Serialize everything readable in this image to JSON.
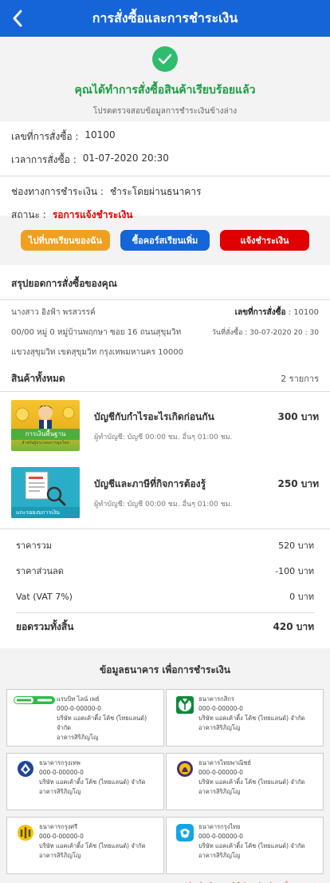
{
  "header": {
    "title": "การสั่งซื้อและการชำระเงิน"
  },
  "success": {
    "message": "คุณได้ทำการสั่งซื้อสินค้าเรียบร้อยแล้ว",
    "sub": "โปรดตรวจสอบข้อมูลการชำระเงินข้างล่าง"
  },
  "order": {
    "number_label": "เลขที่การสั่งซื้อ :",
    "number": "10100",
    "time_label": "เวลาการสั่งซื้อ :",
    "time": "01-07-2020 20:30",
    "payment_label": "ช่องทางการชำระเงิน :",
    "payment": "ชำระโดยผ่านธนาคาร",
    "status_label": "สถานะ :",
    "status": "รอการแจ้งชำระเงิน",
    "status_color": "#e00000"
  },
  "buttons": {
    "my_courses": "ไปที่บทเรียนของฉัน",
    "buy_more": "ซื้อคอร์สเรียนเพิ่ม",
    "notify_payment": "แจ้งชำระเงิน"
  },
  "summary": {
    "title": "สรุปยอดการสั่งซื้อของคุณ",
    "customer_name": "นางสาว อิงฟ้า พรสวรรค์",
    "order_no_label": "เลขที่การสั่งซื้อ",
    "order_no": ": 10100",
    "address1": "00/00 หมู่ 0 หมู่บ้านพฤกษา ซอย 16 ถนนสุขุมวิท",
    "order_date": "วันที่สั่งซื้อ : 30-07-2020 20 : 30",
    "address2": "แขวงสุขุมวิท เขตสุขุมวิท กรุงเทพมหานคร 10000",
    "items_title": "สินค้าทั้งหมด",
    "items_count": "2 รายการ"
  },
  "products": [
    {
      "name": "บัญชีกับกำไรอะไรเกิดก่อนกัน",
      "price": "300 บาท",
      "desc": "ผู้ทำบัญชี: บัญชี 00:00 ชม. อื่นๆ 01:00 ชม.",
      "thumb_caption": "การเงินพื้นฐาน",
      "thumb_sub": "สำหรับผู้ประกอบการยุคใหม่"
    },
    {
      "name": "บัญชีและภาษีที่กิจการต้องรู้",
      "price": "250 บาท",
      "desc": "ผู้ทำบัญชี: บัญชี 00:00 ชม. อื่นๆ 01:00 ชม.",
      "thumb_caption": "แกะรอยงบการเงิน"
    }
  ],
  "totals": {
    "subtotal_label": "ราคารวม",
    "subtotal": "520 บาท",
    "discount_label": "ราคาส่วนลด",
    "discount": "-100 บาท",
    "vat_label": "Vat (VAT 7%)",
    "vat": "0 บาท",
    "grand_label": "ยอดรวมทั้งสิ้น",
    "grand": "420 บาท"
  },
  "banks_title": "ข้อมูลธนาคาร เพื่อการชำระเงิน",
  "banks": [
    {
      "name": "แรบบิท ไลน์ เพย์",
      "account": "000-0-00000-0",
      "company": "บริษัท แอคเค้าติ้ง โค้ช (ไทยแลนด์) จำกัด",
      "branch": "อาคารสิริภิญโญ",
      "logo": "rabbit-linepay",
      "color": "#2ebd44"
    },
    {
      "name": "ธนาคารกสิกร",
      "account": "000-0-00000-0",
      "company": "บริษัท แอคเค้าติ้ง โค้ช (ไทยแลนด์) จำกัด",
      "branch": "อาคารสิริภิญโญ",
      "logo": "kbank",
      "color": "#0a8a3a"
    },
    {
      "name": "ธนาคารกรุงเทพ",
      "account": "000-0-00000-0",
      "company": "บริษัท แอคเค้าติ้ง โค้ช (ไทยแลนด์) จำกัด",
      "branch": "อาคารสิริภิญโญ",
      "logo": "bbl",
      "color": "#1e4598"
    },
    {
      "name": "ธนาคารไทยพาณิชย์",
      "account": "000-0-00000-0",
      "company": "บริษัท แอคเค้าติ้ง โค้ช (ไทยแลนด์) จำกัด",
      "branch": "อาคารสิริภิญโญ",
      "logo": "scb",
      "color": "#4e2a84"
    },
    {
      "name": "ธนาคารกรุงศรี",
      "account": "000-0-00000-0",
      "company": "บริษัท แอคเค้าติ้ง โค้ช (ไทยแลนด์) จำกัด",
      "branch": "อาคารสิริภิญโญ",
      "logo": "krungsri",
      "color": "#f5c400"
    },
    {
      "name": "ธนาคารกรุงไทย",
      "account": "000-0-00000-0",
      "company": "บริษัท แอคเค้าติ้ง โค้ช (ไทยแลนด์) จำกัด",
      "branch": "อาคารสิริภิญโญ",
      "logo": "ktb",
      "color": "#14a5e2"
    }
  ],
  "note": "*ชำระเงินแล้ว กรุณาแจ้งยืนยันการชำระเงินทุกครั้ง ขอบพระคุณค่ะ"
}
